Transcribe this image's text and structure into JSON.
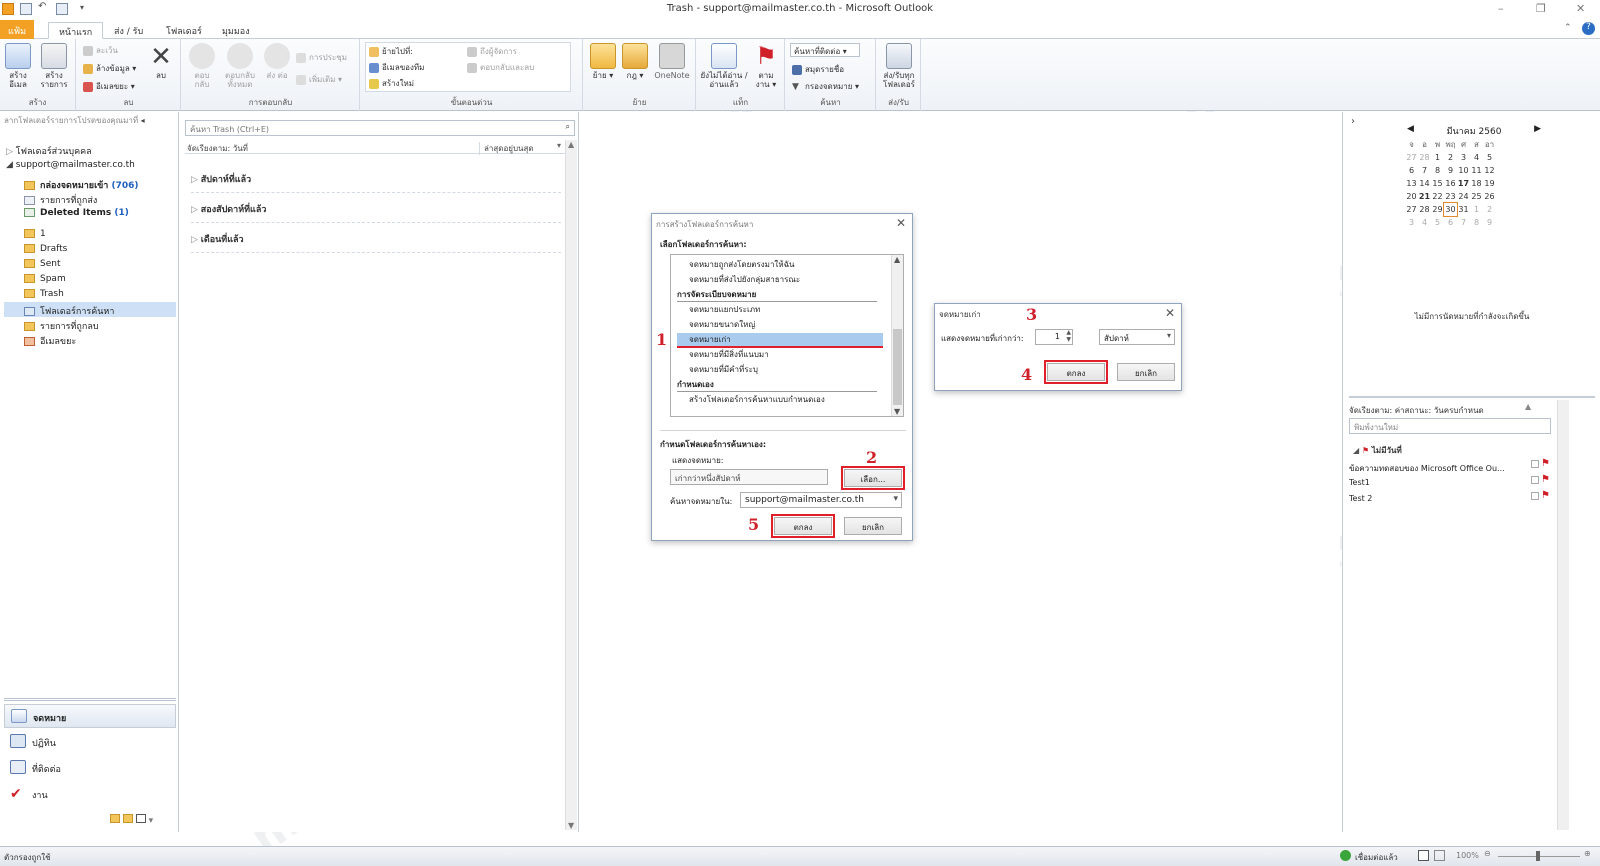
{
  "window": {
    "title": "Trash - support@mailmaster.co.th - Microsoft Outlook"
  },
  "tabs": [
    {
      "label": "แฟ้ม"
    },
    {
      "label": "หน้าแรก"
    },
    {
      "label": "ส่ง / รับ"
    },
    {
      "label": "โฟลเดอร์"
    },
    {
      "label": "มุมมอง"
    }
  ],
  "ribbon": {
    "new_group": {
      "label": "สร้าง",
      "new_email": "สร้าง อีเมล",
      "new_items": "สร้าง รายการ"
    },
    "delete_group": {
      "label": "ลบ",
      "ignore": "ละเว้น",
      "cleanup": "ล้างข้อมูล",
      "junk": "อีเมลขยะ",
      "delete": "ลบ"
    },
    "respond_group": {
      "label": "การตอบกลับ",
      "reply": "ตอบ กลับ",
      "reply_all": "ตอบกลับ ทั้งหมด",
      "forward": "ส่ง ต่อ",
      "meeting": "การประชุม",
      "more": "เพิ่มเติม"
    },
    "quicksteps_group": {
      "label": "ขั้นตอนด่วน",
      "move_to": "ย้ายไปที่:",
      "team_email": "อีเมลของทีม",
      "create_new": "สร้างใหม่",
      "to_manager": "ถึงผู้จัดการ",
      "reply_delete": "ตอบกลับและลบ"
    },
    "move_group": {
      "label": "ย้าย",
      "move": "ย้าย",
      "rules": "กฎ",
      "onenote": "OneNote"
    },
    "tags_group": {
      "label": "แท็ก",
      "unread_read": "ยังไม่ได้อ่าน /อ่านแล้ว",
      "followup": "ตาม งาน"
    },
    "find_group": {
      "label": "ค้นหา",
      "find_contact": "ค้นหาที่ติดต่อ",
      "address_book": "สมุดรายชื่อ",
      "filter_email": "กรองจดหมาย"
    },
    "sendreceive_group": {
      "label": "ส่ง/รับ",
      "send_receive_all": "ส่ง/รับทุก โฟลเดอร์"
    }
  },
  "nav": {
    "drag_hint": "ลากโฟลเดอร์รายการโปรดของคุณมาที่",
    "personal_folders": "โฟลเดอร์ส่วนบุคคล",
    "account": "support@mailmaster.co.th",
    "folders": [
      {
        "label": "กล่องจดหมายเข้า",
        "count": "(706)"
      },
      {
        "label": "รายการที่ถูกส่ง",
        "count": ""
      },
      {
        "label": "Deleted Items",
        "count": "(1)"
      },
      {
        "label": "1",
        "count": ""
      },
      {
        "label": "Drafts",
        "count": ""
      },
      {
        "label": "Sent",
        "count": ""
      },
      {
        "label": "Spam",
        "count": ""
      },
      {
        "label": "Trash",
        "count": ""
      },
      {
        "label": "โฟลเดอร์การค้นหา",
        "count": ""
      },
      {
        "label": "รายการที่ถูกลบ",
        "count": ""
      },
      {
        "label": "อีเมลขยะ",
        "count": ""
      }
    ],
    "bottom": {
      "mail": "จดหมาย",
      "calendar": "ปฏิทิน",
      "contacts": "ที่ติดต่อ",
      "tasks": "งาน"
    }
  },
  "list": {
    "search_placeholder": "ค้นหา Trash (Ctrl+E)",
    "arrange_by": "จัดเรียงตาม: วันที่",
    "newest_top": "ล่าสุดอยู่บนสุด",
    "groups": [
      "สัปดาห์ที่แล้ว",
      "สองสัปดาห์ที่แล้ว",
      "เดือนที่แล้ว"
    ]
  },
  "search_folder_dialog": {
    "title": "การสร้างโฟลเดอร์การค้นหา",
    "select_label": "เลือกโฟลเดอร์การค้นหา:",
    "items": [
      {
        "type": "option",
        "label": "จดหมายถูกส่งโดยตรงมาให้ฉัน"
      },
      {
        "type": "option",
        "label": "จดหมายที่ส่งไปยังกลุ่มสาธารณะ"
      },
      {
        "type": "section",
        "label": "การจัดระเบียบจดหมาย"
      },
      {
        "type": "option",
        "label": "จดหมายแยกประเภท"
      },
      {
        "type": "option",
        "label": "จดหมายขนาดใหญ่"
      },
      {
        "type": "option",
        "label": "จดหมายเก่า",
        "selected": true
      },
      {
        "type": "option",
        "label": "จดหมายที่มีสิ่งที่แนบมา"
      },
      {
        "type": "option",
        "label": "จดหมายที่มีคำที่ระบุ"
      },
      {
        "type": "section",
        "label": "กำหนดเอง"
      },
      {
        "type": "option",
        "label": "สร้างโฟลเดอร์การค้นหาแบบกำหนดเอง"
      }
    ],
    "customize_label": "กำหนดโฟลเดอร์การค้นหาเอง:",
    "show_mail_label": "แสดงจดหมาย:",
    "show_mail_value": "เก่ากว่าหนึ่งสัปดาห์",
    "choose_button": "เลือก...",
    "search_in_label": "ค้นหาจดหมายใน:",
    "search_in_value": "support@mailmaster.co.th",
    "ok": "ตกลง",
    "cancel": "ยกเลิก"
  },
  "old_mail_dialog": {
    "title": "จดหมายเก่า",
    "show_older_label": "แสดงจดหมายที่เก่ากว่า:",
    "number_value": "1",
    "unit_value": "สัปดาห์",
    "ok": "ตกลง",
    "cancel": "ยกเลิก"
  },
  "annotations": [
    "1",
    "2",
    "3",
    "4",
    "5"
  ],
  "calendar": {
    "month": "มีนาคม 2560",
    "weekdays": [
      "จ",
      "อ",
      "พ",
      "พฤ",
      "ศ",
      "ส",
      "อา"
    ],
    "weeks": [
      [
        "27",
        "28",
        "1",
        "2",
        "3",
        "4",
        "5"
      ],
      [
        "6",
        "7",
        "8",
        "9",
        "10",
        "11",
        "12"
      ],
      [
        "13",
        "14",
        "15",
        "16",
        "17",
        "18",
        "19"
      ],
      [
        "20",
        "21",
        "22",
        "23",
        "24",
        "25",
        "26"
      ],
      [
        "27",
        "28",
        "29",
        "30",
        "31",
        "1",
        "2"
      ],
      [
        "3",
        "4",
        "5",
        "6",
        "7",
        "8",
        "9"
      ]
    ],
    "no_appointments": "ไม่มีการนัดหมายที่กำลังจะเกิดขึ้น"
  },
  "tasks": {
    "arrange_by": "จัดเรียงตาม: ค่าสถานะ: วันครบกำหนด",
    "new_task_placeholder": "พิมพ์งานใหม่",
    "group": "ไม่มีวันที่",
    "items": [
      "ข้อความทดสอบของ Microsoft Office Ou...",
      "Test1",
      "Test 2"
    ]
  },
  "status": {
    "left": "ตัวกรองถูกใช้",
    "connected": "เชื่อมต่อแล้ว",
    "zoom": "100%"
  },
  "watermark": "mail master",
  "colors": {
    "accent_red": "#e01f2a",
    "file_tab": "#f2a125",
    "selection": "#cde0f5",
    "link_blue": "#1f5fbf"
  }
}
